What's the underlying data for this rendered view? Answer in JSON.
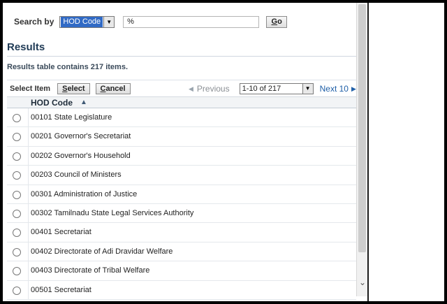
{
  "search": {
    "label": "Search by",
    "field_value": "HOD Code",
    "query_value": "%",
    "go_label_first": "G",
    "go_label_rest": "o"
  },
  "results": {
    "heading": "Results",
    "summary": "Results table contains 217 items."
  },
  "toolbar": {
    "select_item_label": "Select Item",
    "select_button_first": "S",
    "select_button_rest": "elect",
    "cancel_button_first": "C",
    "cancel_button_rest": "ancel",
    "previous_label": "Previous",
    "range_value": "1-10 of 217",
    "next_label": "Next 10"
  },
  "table": {
    "column_header": "HOD Code",
    "sort_direction": "ascending",
    "rows": [
      "00101 State Legislature",
      "00201 Governor's Secretariat",
      "00202 Governor's Household",
      "00203 Council of Ministers",
      "00301 Administration of Justice",
      "00302 Tamilnadu State Legal Services Authority",
      "00401 Secretariat",
      "00402 Directorate of Adi Dravidar Welfare",
      "00403 Directorate of Tribal Welfare",
      "00501 Secretariat"
    ]
  },
  "icons": {
    "dropdown": "chevron-down-icon",
    "previous": "triangle-left-icon",
    "next": "triangle-right-icon",
    "sort": "sort-ascending-icon",
    "scroll": "scroll-down-icon"
  },
  "colors": {
    "selection": "#316ac5",
    "link": "#2060a8",
    "heading": "#1f3a55"
  }
}
